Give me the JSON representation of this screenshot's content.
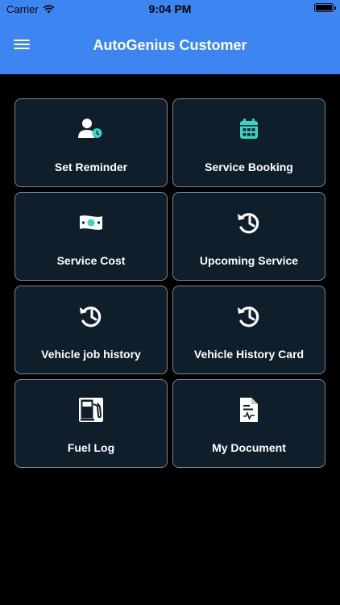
{
  "status_bar": {
    "carrier": "Carrier",
    "time": "9:04 PM"
  },
  "app_bar": {
    "title": "AutoGenius Customer",
    "menu_icon": "hamburger-menu-icon"
  },
  "colors": {
    "primary": "#3d86f2",
    "tile_bg": "#0f1e2b",
    "tile_border": "#7a8690",
    "accent": "#39d6c6"
  },
  "tiles": [
    {
      "label": "Set Reminder",
      "icon": "user-reminder-icon"
    },
    {
      "label": "Service Booking",
      "icon": "calendar-icon"
    },
    {
      "label": "Service Cost",
      "icon": "cash-icon"
    },
    {
      "label": "Upcoming Service",
      "icon": "history-icon"
    },
    {
      "label": "Vehicle job history",
      "icon": "history-icon"
    },
    {
      "label": "Vehicle History Card",
      "icon": "history-icon"
    },
    {
      "label": "Fuel Log",
      "icon": "fuel-pump-icon"
    },
    {
      "label": "My Document",
      "icon": "document-icon"
    }
  ]
}
